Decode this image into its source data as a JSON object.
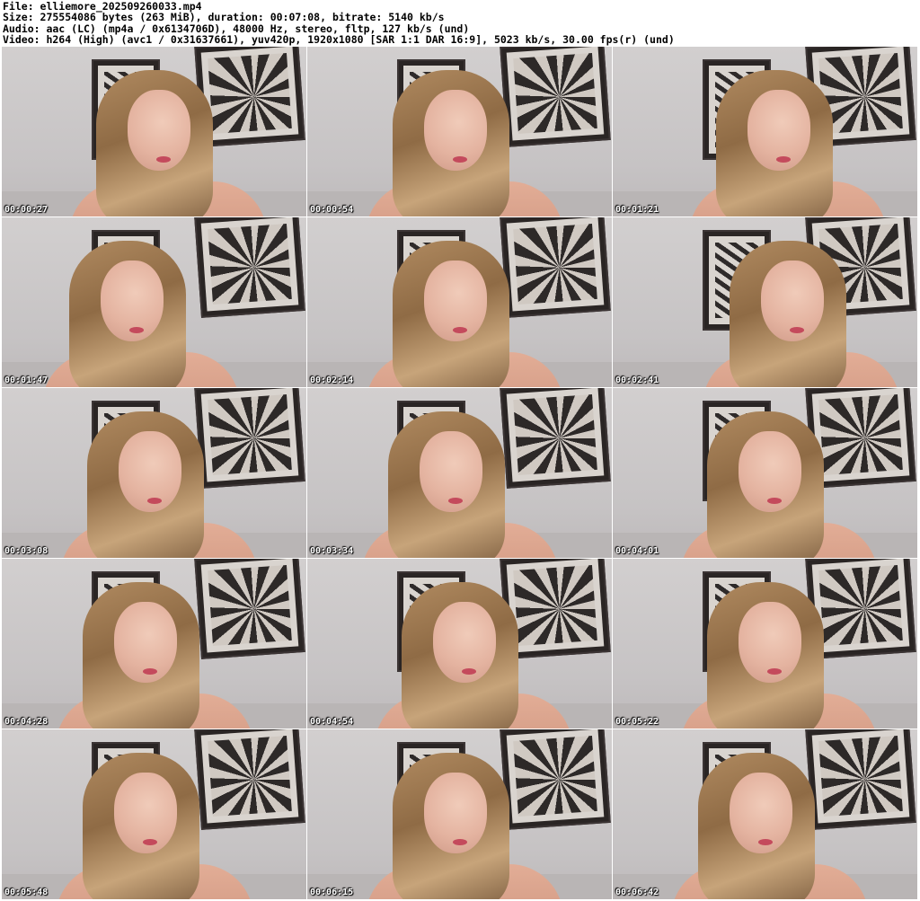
{
  "header": {
    "file_line": "File: elliemore_202509260033.mp4",
    "size_line": "Size: 275554086 bytes (263 MiB), duration: 00:07:08, bitrate: 5140 kb/s",
    "audio_line": "Audio: aac (LC) (mp4a / 0x6134706D), 48000 Hz, stereo, fltp, 127 kb/s (und)",
    "video_line": "Video: h264 (High) (avc1 / 0x31637661), yuv420p, 1920x1080 [SAR 1:1 DAR 16:9], 5023 kb/s, 30.00 fps(r) (und)"
  },
  "thumbnails": [
    {
      "timestamp": "00:00:27"
    },
    {
      "timestamp": "00:00:54"
    },
    {
      "timestamp": "00:01:21"
    },
    {
      "timestamp": "00:01:47"
    },
    {
      "timestamp": "00:02:14"
    },
    {
      "timestamp": "00:02:41"
    },
    {
      "timestamp": "00:03:08"
    },
    {
      "timestamp": "00:03:34"
    },
    {
      "timestamp": "00:04:01"
    },
    {
      "timestamp": "00:04:28"
    },
    {
      "timestamp": "00:04:54"
    },
    {
      "timestamp": "00:05:22"
    },
    {
      "timestamp": "00:05:48"
    },
    {
      "timestamp": "00:06:15"
    },
    {
      "timestamp": "00:06:42"
    }
  ]
}
